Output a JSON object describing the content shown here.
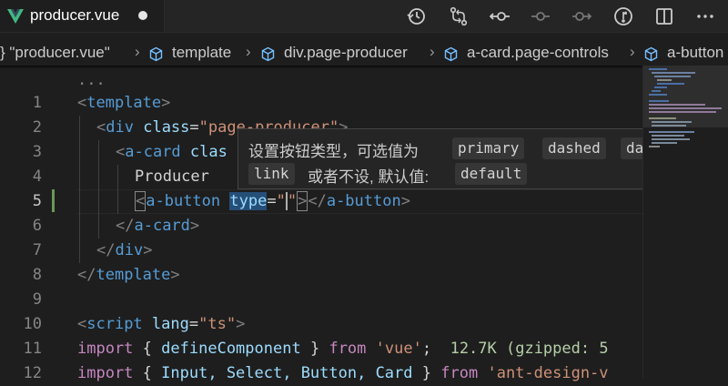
{
  "tab": {
    "title": "producer.vue"
  },
  "breadcrumb": [
    "} \"producer.vue\"",
    "template",
    "div.page-producer",
    "a-card.page-controls",
    "a-button"
  ],
  "editor": {
    "fold_ellipsis": "...",
    "line_numbers": [
      "1",
      "2",
      "3",
      "4",
      "5",
      "6",
      "7",
      "8",
      "9",
      "10",
      "11",
      "12"
    ],
    "active_line": "5",
    "lines": {
      "l1": {
        "open": "<",
        "tag": "template",
        "close": ">"
      },
      "l2": {
        "open": "<",
        "tag": "div",
        "attr": "class",
        "eq": "=",
        "val": "\"page-producer\"",
        "close": ">"
      },
      "l3": {
        "open": "<",
        "tag": "a-card",
        "attr": "clas"
      },
      "l4": {
        "text": "Producer"
      },
      "l5": {
        "open": "<",
        "tag": "a-button",
        "attr": "type",
        "eq": "=",
        "q1": "\"",
        "q2": "\"",
        "close": ">",
        "endopen": "</",
        "endtag": "a-button",
        "endclose": ">"
      },
      "l6": {
        "open": "</",
        "tag": "a-card",
        "close": ">"
      },
      "l7": {
        "open": "</",
        "tag": "div",
        "close": ">"
      },
      "l8": {
        "open": "</",
        "tag": "template",
        "close": ">"
      },
      "l10": {
        "open": "<",
        "tag": "script",
        "attr": "lang",
        "eq": "=",
        "val": "\"ts\"",
        "close": ">"
      },
      "l11": {
        "kw": "import",
        "b1": "{",
        "name": "defineComponent",
        "b2": "}",
        "from": "from",
        "src": "'vue'",
        "semi": ";",
        "hint": "12.7K (gzipped: 5"
      },
      "l12": {
        "kw": "import",
        "b1": "{",
        "names": "Input, Select, Button, Card",
        "b2": "}",
        "from": "from",
        "src": "'ant-design-v"
      }
    }
  },
  "tooltip": {
    "desc": "设置按钮类型，可选值为",
    "options": [
      "primary",
      "dashed",
      "danger",
      "link"
    ],
    "or_text": "或者不设, 默认值:",
    "default_value": "default"
  },
  "colors": {
    "vue_green": "#41b883",
    "vue_dark": "#35495e",
    "modified": "#6a9955"
  },
  "icons": [
    "vue-file-icon",
    "history-icon",
    "compare-changes-icon",
    "go-back-icon",
    "go-forward-icon",
    "open-changes-icon",
    "source-control-icon",
    "split-editor-icon",
    "more-actions-icon",
    "cube-icon"
  ]
}
